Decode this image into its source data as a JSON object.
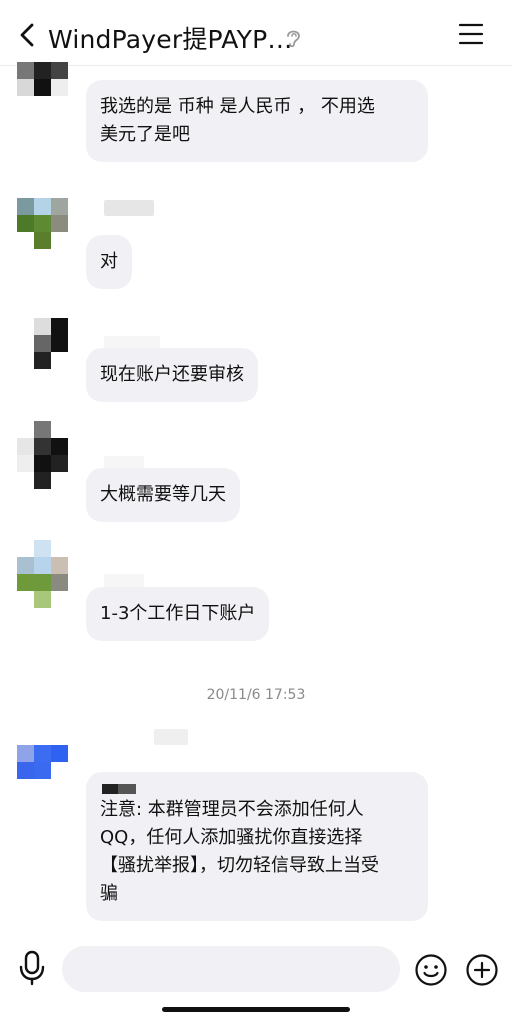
{
  "header": {
    "title": "WindPayer提PAYP…",
    "back_icon": "chevron-left-icon",
    "ear_icon": "ear-icon",
    "menu_icon": "hamburger-menu-icon"
  },
  "messages": [
    {
      "text_lines": [
        "我选的是 币种 是人民币 ， 不用选",
        "美元了是吧"
      ]
    },
    {
      "text_lines": [
        "对"
      ]
    },
    {
      "text_lines": [
        "现在账户还要审核"
      ]
    },
    {
      "text_lines": [
        "大概需要等几天"
      ]
    },
    {
      "text_lines": [
        "1-3个工作日下账户"
      ]
    },
    {
      "text_lines": [
        "注意: 本群管理员不会添加任何人",
        "QQ，任何人添加骚扰你直接选择",
        "【骚扰举报】，切勿轻信导致上当受",
        "骗"
      ]
    }
  ],
  "timestamp": "20/11/6 17:53",
  "input": {
    "placeholder": ""
  },
  "icons": {
    "mic": "microphone-icon",
    "emoji": "smiley-icon",
    "plus": "plus-circle-icon"
  }
}
